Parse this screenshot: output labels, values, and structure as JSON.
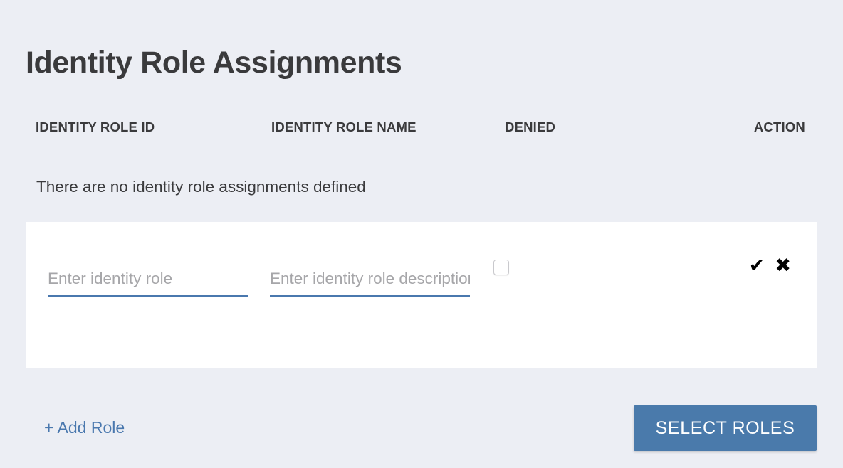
{
  "page": {
    "title": "Identity Role Assignments",
    "background_color": "#eceef4",
    "accent_color": "#4a7aab"
  },
  "table": {
    "headers": [
      {
        "label": "IDENTITY ROLE ID"
      },
      {
        "label": "IDENTITY ROLE NAME"
      },
      {
        "label": "DENIED"
      },
      {
        "label": "ACTION"
      }
    ],
    "empty_message": "There are no identity role assignments defined"
  },
  "edit_row": {
    "identity_role": {
      "value": "",
      "placeholder": "Enter identity role"
    },
    "identity_role_name": {
      "value": "",
      "placeholder": "Enter identity role description"
    },
    "denied": {
      "checked": false
    },
    "actions": {
      "confirm_icon": "✔",
      "cancel_icon": "✖"
    }
  },
  "footer": {
    "add_role_label": "+ Add Role",
    "select_roles_label": "SELECT ROLES"
  }
}
